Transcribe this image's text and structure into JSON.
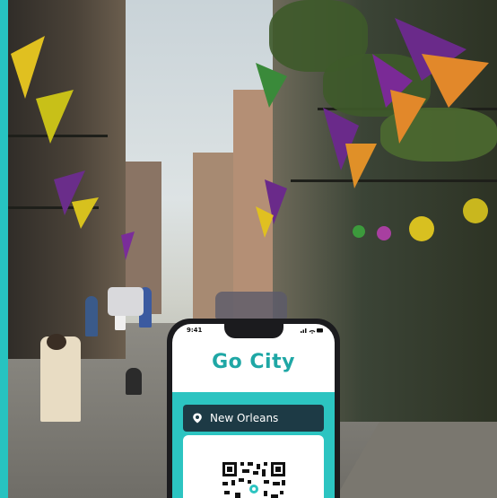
{
  "status_bar": {
    "time": "9:41",
    "icons": "…•▮"
  },
  "app": {
    "logo_text": "Go City",
    "city_label": "New Orleans"
  },
  "icons": {
    "pin": "location-pin-icon",
    "qr": "qr-code-icon"
  },
  "colors": {
    "brand_teal": "#2cc4c1",
    "logo_teal": "#1fa7a5",
    "pill_navy": "#1d3a45"
  }
}
